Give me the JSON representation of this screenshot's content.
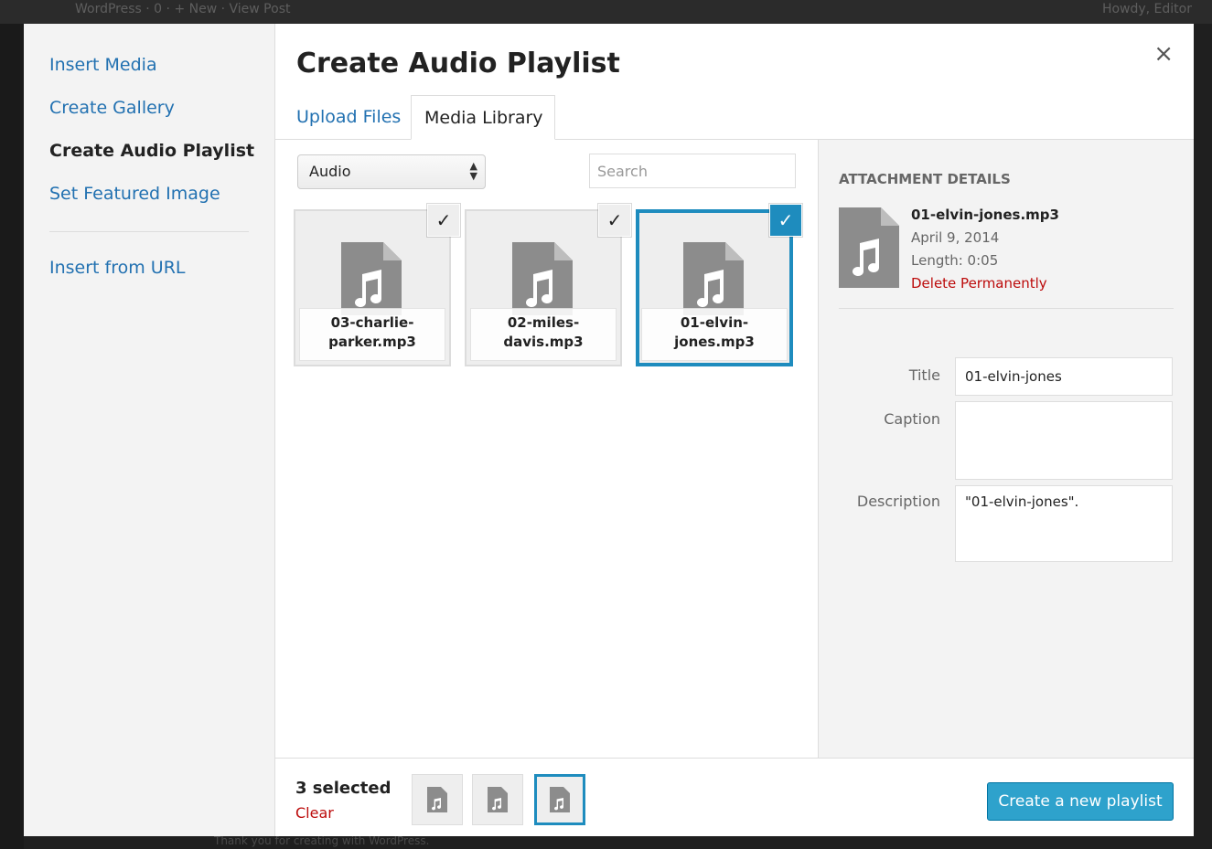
{
  "admin_bar": {
    "left_text": "WordPress  ·  0  ·  + New  ·  View Post",
    "right_text": "Howdy, Editor"
  },
  "footer_hint": "Thank you for creating with WordPress.",
  "menu": {
    "items": [
      {
        "label": "Insert Media",
        "active": false
      },
      {
        "label": "Create Gallery",
        "active": false
      },
      {
        "label": "Create Audio Playlist",
        "active": true
      },
      {
        "label": "Set Featured Image",
        "active": false
      }
    ],
    "insert_from_url": "Insert from URL"
  },
  "title": "Create Audio Playlist",
  "close_icon": "×",
  "tabs": [
    {
      "label": "Upload Files",
      "active": false
    },
    {
      "label": "Media Library",
      "active": true
    }
  ],
  "filter": {
    "selected": "Audio"
  },
  "search": {
    "placeholder": "Search",
    "value": ""
  },
  "attachments": [
    {
      "filename": "03-charlie-parker.mp3",
      "line1": "03-charlie-",
      "line2": "parker.mp3",
      "selected": true,
      "details": false,
      "icon": "audio-file-icon"
    },
    {
      "filename": "02-miles-davis.mp3",
      "line1": "02-miles-",
      "line2": "davis.mp3",
      "selected": true,
      "details": false,
      "icon": "audio-file-icon"
    },
    {
      "filename": "01-elvin-jones.mp3",
      "line1": "01-elvin-",
      "line2": "jones.mp3",
      "selected": true,
      "details": true,
      "icon": "audio-file-icon"
    }
  ],
  "check_glyph": "✓",
  "details": {
    "heading": "ATTACHMENT DETAILS",
    "filename": "01-elvin-jones.mp3",
    "date": "April 9, 2014",
    "length": "Length: 0:05",
    "delete_label": "Delete Permanently",
    "fields": {
      "title_label": "Title",
      "title_value": "01-elvin-jones",
      "caption_label": "Caption",
      "caption_value": "",
      "description_label": "Description",
      "description_value": "\"01-elvin-jones\"."
    }
  },
  "selection": {
    "count_label": "3 selected",
    "clear_label": "Clear"
  },
  "create_button": "Create a new playlist",
  "colors": {
    "link": "#2271b1",
    "delete": "#bc0b0b",
    "accent": "#1e8cbe",
    "button": "#2ea2cc"
  }
}
